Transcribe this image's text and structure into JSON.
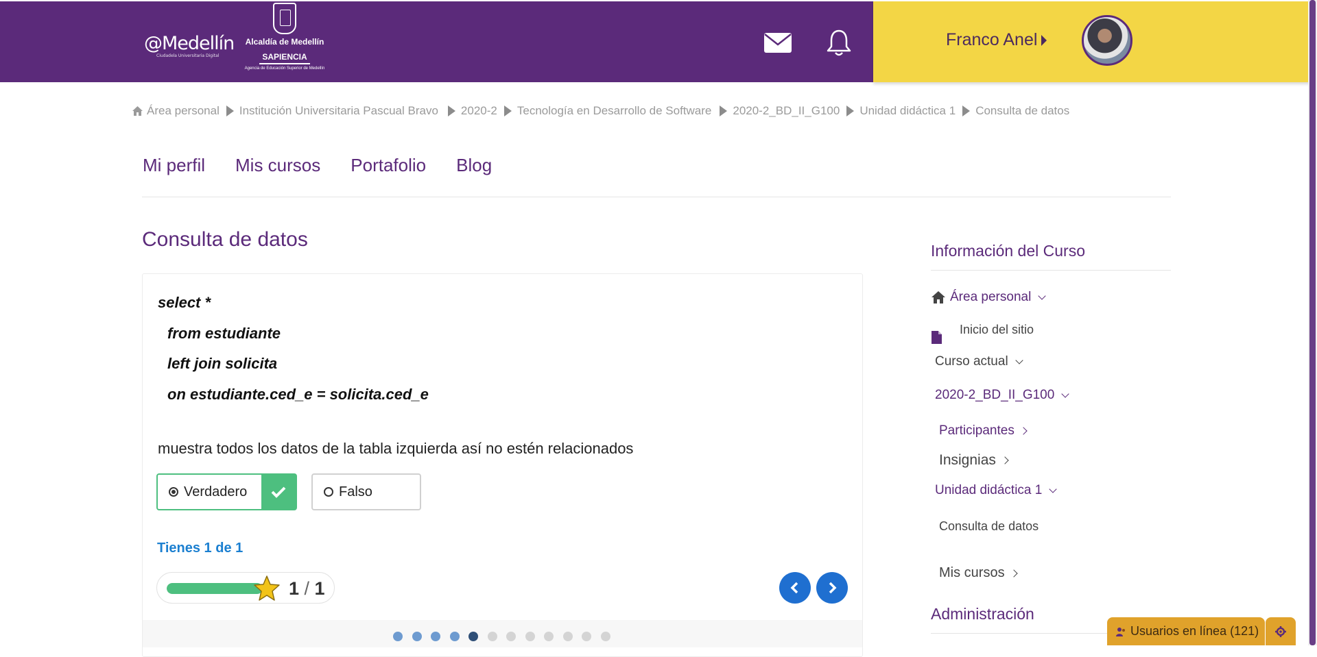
{
  "header": {
    "logo_main": "@Medellín",
    "logo_main_sub": "Ciudadela Universitaria Digital",
    "logo_alcaldia": "Alcaldía de Medellín",
    "logo_sapiencia": "SAPIENCIA",
    "logo_sapiencia_sub": "Agencia de Educación Superior de Medellín",
    "username": "Franco Anel",
    "colors": {
      "primary": "#5b2a7a",
      "accent": "#f3d645"
    },
    "icons": [
      "mail-icon",
      "bell-icon"
    ]
  },
  "breadcrumb": [
    "Área personal",
    "Institución Universitaria Pascual Bravo",
    "2020-2",
    "Tecnología en Desarrollo de Software",
    "2020-2_BD_II_G100",
    "Unidad didáctica 1",
    "Consulta de datos"
  ],
  "nav": {
    "tabs": [
      "Mi perfil",
      "Mis cursos",
      "Portafolio",
      "Blog"
    ]
  },
  "main": {
    "title": "Consulta de datos",
    "code_lines": [
      "select *",
      "from estudiante",
      "left join solicita",
      "on estudiante.ced_e = solicita.ced_e"
    ],
    "statement": "muestra todos los datos de la tabla izquierda así no estén relacionados",
    "options": [
      {
        "label": "Verdadero",
        "selected": true,
        "correct": true
      },
      {
        "label": "Falso",
        "selected": false
      }
    ],
    "score_text": "Tienes 1 de 1",
    "progress_fraction": 1.0,
    "score_value": "1",
    "score_total": "1",
    "pagination": {
      "total_dots": 12,
      "current_index": 4
    },
    "colors": {
      "correct": "#4dbf7f",
      "link": "#1b7fd0",
      "nav_button": "#1f6fd0"
    }
  },
  "sidebar": {
    "title": "Información del Curso",
    "items": {
      "area_personal": "Área personal",
      "inicio_sitio": "Inicio del sitio",
      "curso_actual": "Curso actual",
      "curso_codigo": "2020-2_BD_II_G100",
      "participantes": "Participantes",
      "insignias": "Insignias",
      "unidad": "Unidad didáctica 1",
      "consulta": "Consulta de datos",
      "mis_cursos": "Mis cursos"
    },
    "admin_title": "Administración"
  },
  "online_widget": {
    "label": "Usuarios en línea (121)"
  }
}
